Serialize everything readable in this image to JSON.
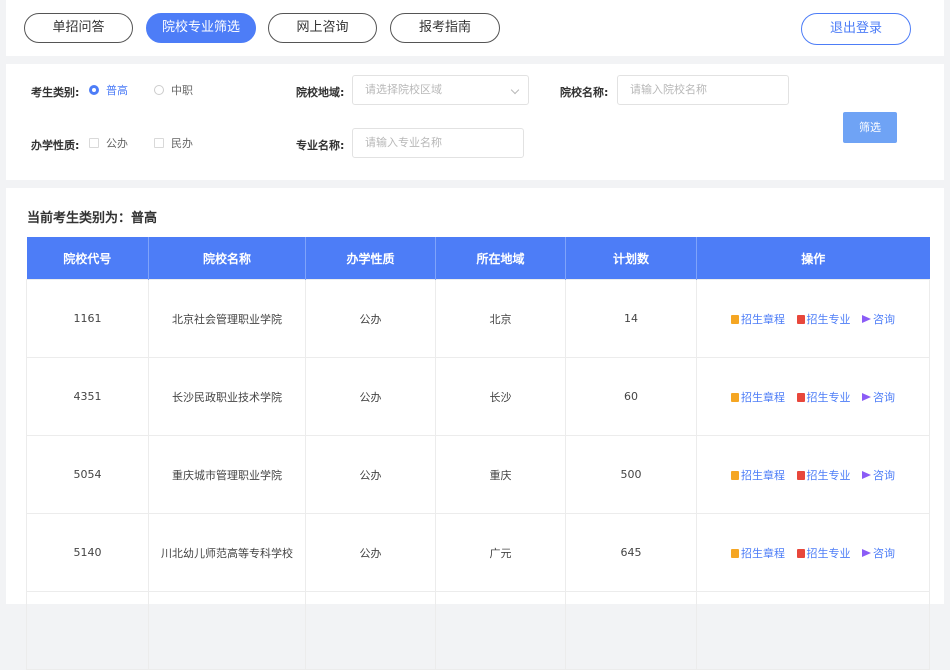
{
  "nav": {
    "tabs": [
      "单招问答",
      "院校专业筛选",
      "网上咨询",
      "报考指南"
    ],
    "active_index": 1,
    "logout_label": "退出登录"
  },
  "filters": {
    "student_type_label": "考生类别:",
    "student_type_options": [
      "普高",
      "中职"
    ],
    "student_type_selected": "普高",
    "region_label": "院校地域:",
    "region_placeholder": "请选择院校区域",
    "school_name_label": "院校名称:",
    "school_name_placeholder": "请输入院校名称",
    "nature_label": "办学性质:",
    "nature_options": [
      "公办",
      "民办"
    ],
    "major_label": "专业名称:",
    "major_placeholder": "请输入专业名称",
    "filter_button": "筛选"
  },
  "current": {
    "text": "当前考生类别为：普高"
  },
  "table": {
    "headers": [
      "院校代号",
      "院校名称",
      "办学性质",
      "所在地域",
      "计划数",
      "操作"
    ],
    "rows": [
      {
        "code": "1161",
        "name": "北京社会管理职业学院",
        "nature": "公办",
        "region": "北京",
        "plan": "14"
      },
      {
        "code": "4351",
        "name": "长沙民政职业技术学院",
        "nature": "公办",
        "region": "长沙",
        "plan": "60"
      },
      {
        "code": "5054",
        "name": "重庆城市管理职业学院",
        "nature": "公办",
        "region": "重庆",
        "plan": "500"
      },
      {
        "code": "5140",
        "name": "川北幼儿师范高等专科学校",
        "nature": "公办",
        "region": "广元",
        "plan": "645"
      },
      {
        "code": "",
        "name": "",
        "nature": "",
        "region": "",
        "plan": ""
      }
    ],
    "actions": {
      "brochure": "招生章程",
      "brochure_icon": "book-icon",
      "major": "招生专业",
      "major_icon": "list-icon",
      "consult": "咨询",
      "consult_icon": "send-icon"
    }
  },
  "colors": {
    "primary": "#4d7df7",
    "filter_button": "#6fa3f5",
    "brochure_icon": "#f5a623",
    "major_icon": "#e8473b",
    "consult_icon": "#8b5cf6"
  }
}
